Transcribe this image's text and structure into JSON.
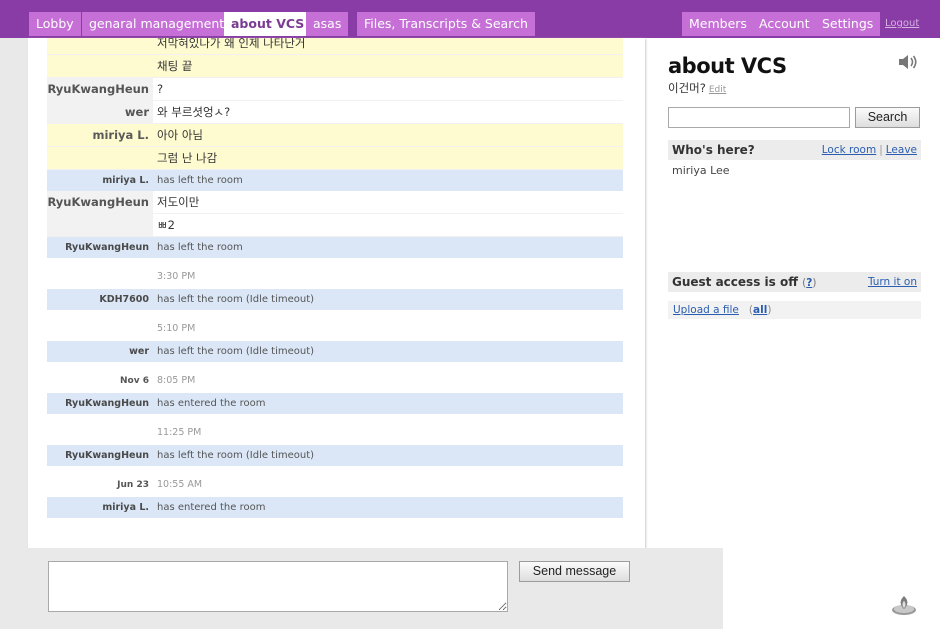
{
  "nav": {
    "tabs": [
      {
        "label": "Lobby"
      },
      {
        "label": "genaral management"
      },
      {
        "label": "about VCS"
      },
      {
        "label": "asas"
      },
      {
        "label": "Files, Transcripts & Search"
      }
    ],
    "right": [
      {
        "label": "Members"
      },
      {
        "label": "Account"
      },
      {
        "label": "Settings"
      }
    ],
    "logout": "Logout"
  },
  "chat": {
    "rows": [
      {
        "kind": "msg",
        "style": "yellow",
        "who": "",
        "text": "저막혀있나가 왜 인제 나타난거"
      },
      {
        "kind": "msg",
        "style": "yellow",
        "who": "",
        "text": "채팅 끝"
      },
      {
        "kind": "msg",
        "style": "white",
        "who": "RyuKwangHeun",
        "text": "?"
      },
      {
        "kind": "msg",
        "style": "white",
        "who": "wer",
        "text": "와 부르셧엉ㅅ?"
      },
      {
        "kind": "msg",
        "style": "yellow",
        "who": "miriya L.",
        "text": "아아 아님"
      },
      {
        "kind": "msg",
        "style": "yellow",
        "who": "",
        "text": "그럼 난 나감"
      },
      {
        "kind": "event",
        "who": "miriya L.",
        "text": "has left the room"
      },
      {
        "kind": "msg",
        "style": "white",
        "who": "RyuKwangHeun",
        "text": "저도이만"
      },
      {
        "kind": "msg",
        "style": "white",
        "who": "",
        "text": "ㅃ2"
      },
      {
        "kind": "event",
        "who": "RyuKwangHeun",
        "text": "has left the room"
      },
      {
        "kind": "time",
        "who": "",
        "text": "3:30 PM"
      },
      {
        "kind": "event",
        "who": "KDH7600",
        "text": "has left the room (Idle timeout)"
      },
      {
        "kind": "time",
        "who": "",
        "text": "5:10 PM"
      },
      {
        "kind": "event",
        "who": "wer",
        "text": "has left the room (Idle timeout)"
      },
      {
        "kind": "time",
        "who": "Nov 6",
        "text": "8:05 PM"
      },
      {
        "kind": "event",
        "who": "RyuKwangHeun",
        "text": "has entered the room"
      },
      {
        "kind": "time",
        "who": "",
        "text": "11:25 PM"
      },
      {
        "kind": "event",
        "who": "RyuKwangHeun",
        "text": "has left the room (Idle timeout)"
      },
      {
        "kind": "time",
        "who": "Jun 23",
        "text": "10:55 AM"
      },
      {
        "kind": "event",
        "who": "miriya L.",
        "text": "has entered the room"
      }
    ]
  },
  "composer": {
    "value": "",
    "send_label": "Send message"
  },
  "sidebar": {
    "room_title": "about VCS",
    "room_topic": "이건머?",
    "edit_label": "Edit",
    "search_value": "",
    "search_label": "Search",
    "whos_here": {
      "heading": "Who's here?",
      "lock_label": "Lock room",
      "sep": "|",
      "leave_label": "Leave",
      "members": [
        "miriya Lee"
      ]
    },
    "guest": {
      "heading": "Guest access is off",
      "help_open": "(",
      "help_label": "?",
      "help_close": ")",
      "turn_on_label": "Turn it on"
    },
    "upload": {
      "label": "Upload a file",
      "all_open": "(",
      "all_label": "all",
      "all_close": ")"
    }
  },
  "icons": {
    "speaker": "speaker-icon",
    "campfire": "campfire-icon"
  },
  "colors": {
    "nav_bg": "#8a3ca6",
    "tab_bg": "#c66fd6",
    "yellow_row": "#fefbd0",
    "event_row": "#dbe7f7",
    "link": "#2a5db0"
  }
}
